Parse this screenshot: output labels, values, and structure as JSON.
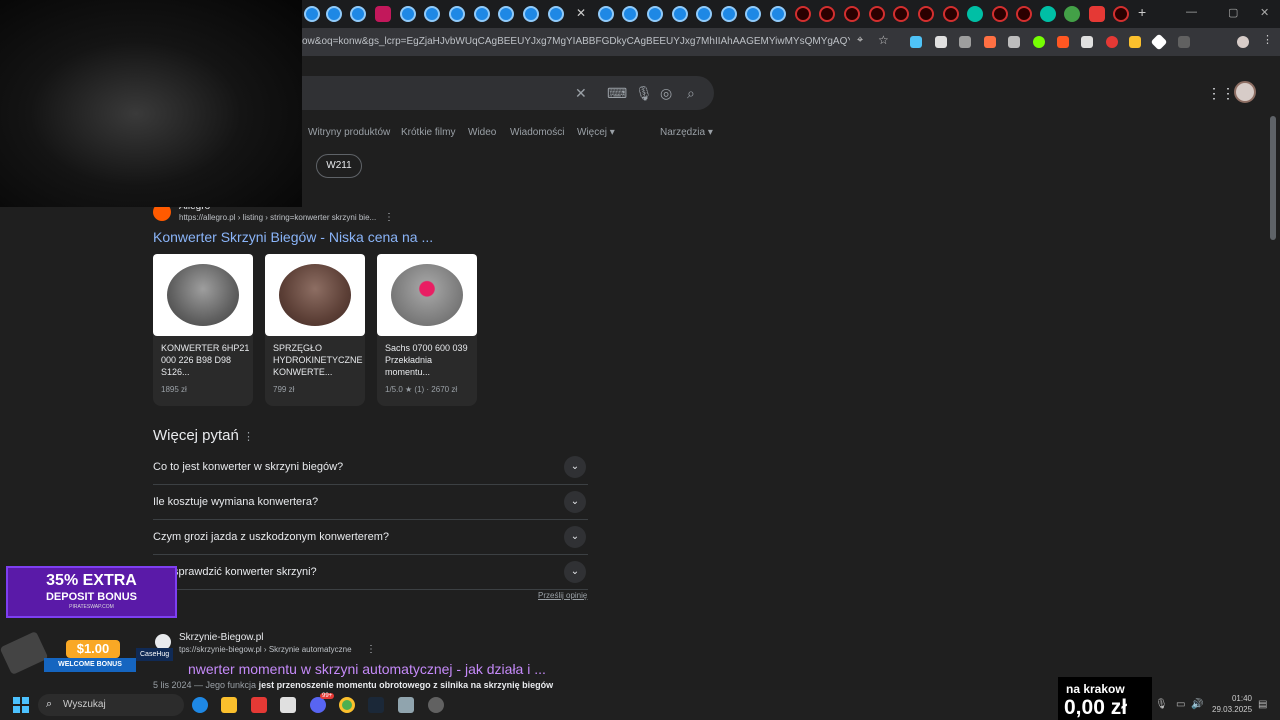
{
  "browser": {
    "url": "ow&oq=konw&gs_lcrp=EgZjaHJvbWUqCAgBEEUYJxg7MgYIABBFGDkyCAgBEEUYJxg7MhIIAhAAGEMYiwMYsQMYgAQYigUyCggDEA..."
  },
  "navtabs": [
    "Witryny produktów",
    "Krótkie filmy",
    "Wideo",
    "Wiadomości",
    "Więcej",
    "Narzędzia"
  ],
  "chip": "W211",
  "result1": {
    "site": "Allegro",
    "crumb": "https://allegro.pl › listing › string=konwerter skrzyni bie...",
    "title": "Konwerter Skrzyni Biegów - Niska cena na ..."
  },
  "products": [
    {
      "name": "KONWERTER 6HP21 000 226 B98 D98 S126...",
      "price": "1895 zł"
    },
    {
      "name": "SPRZĘGŁO HYDROKINETYCZNE KONWERTE...",
      "price": "799 zł"
    },
    {
      "name": "Sachs 0700 600 039 Przekładnia momentu...",
      "price": "1/5.0 ★ (1) · 2670 zł"
    }
  ],
  "more_questions": {
    "title": "Więcej pytań",
    "items": [
      "Co to jest konwerter w skrzyni biegów?",
      "Ile kosztuje wymiana konwertera?",
      "Czym grozi jazda z uszkodzonym konwerterem?",
      "sprawdzić konwerter skrzyni?"
    ],
    "feedback": "Prześlij opinię"
  },
  "result2": {
    "site": "Skrzynie-Biegow.pl",
    "crumb": "tps://skrzynie-biegow.pl › Skrzynie automatyczne",
    "title": "nwerter momentu w skrzyni automatycznej - jak działa i ...",
    "snippet_prefix": "5 lis 2024 — Jego funkcja ",
    "snippet_bold": "jest przenoszenie momentu obrotowego z silnika na skrzynię biegów"
  },
  "promo": {
    "line1": "35% EXTRA",
    "line2": "DEPOSIT BONUS",
    "line3": "PIRATESWAP.COM",
    "amount": "$1.00",
    "welcome": "WELCOME BONUS",
    "brand": "CaseHug"
  },
  "taskbar": {
    "search": "Wyszukaj",
    "badge": "99+",
    "time": "01:40",
    "date": "29.03.2025"
  },
  "overlay": {
    "location": "na krakow",
    "amount": "0,00 zł"
  },
  "colors": {
    "link": "#8ab4f8",
    "bg": "#1f1f1f",
    "promo": "#5a1aa8"
  }
}
